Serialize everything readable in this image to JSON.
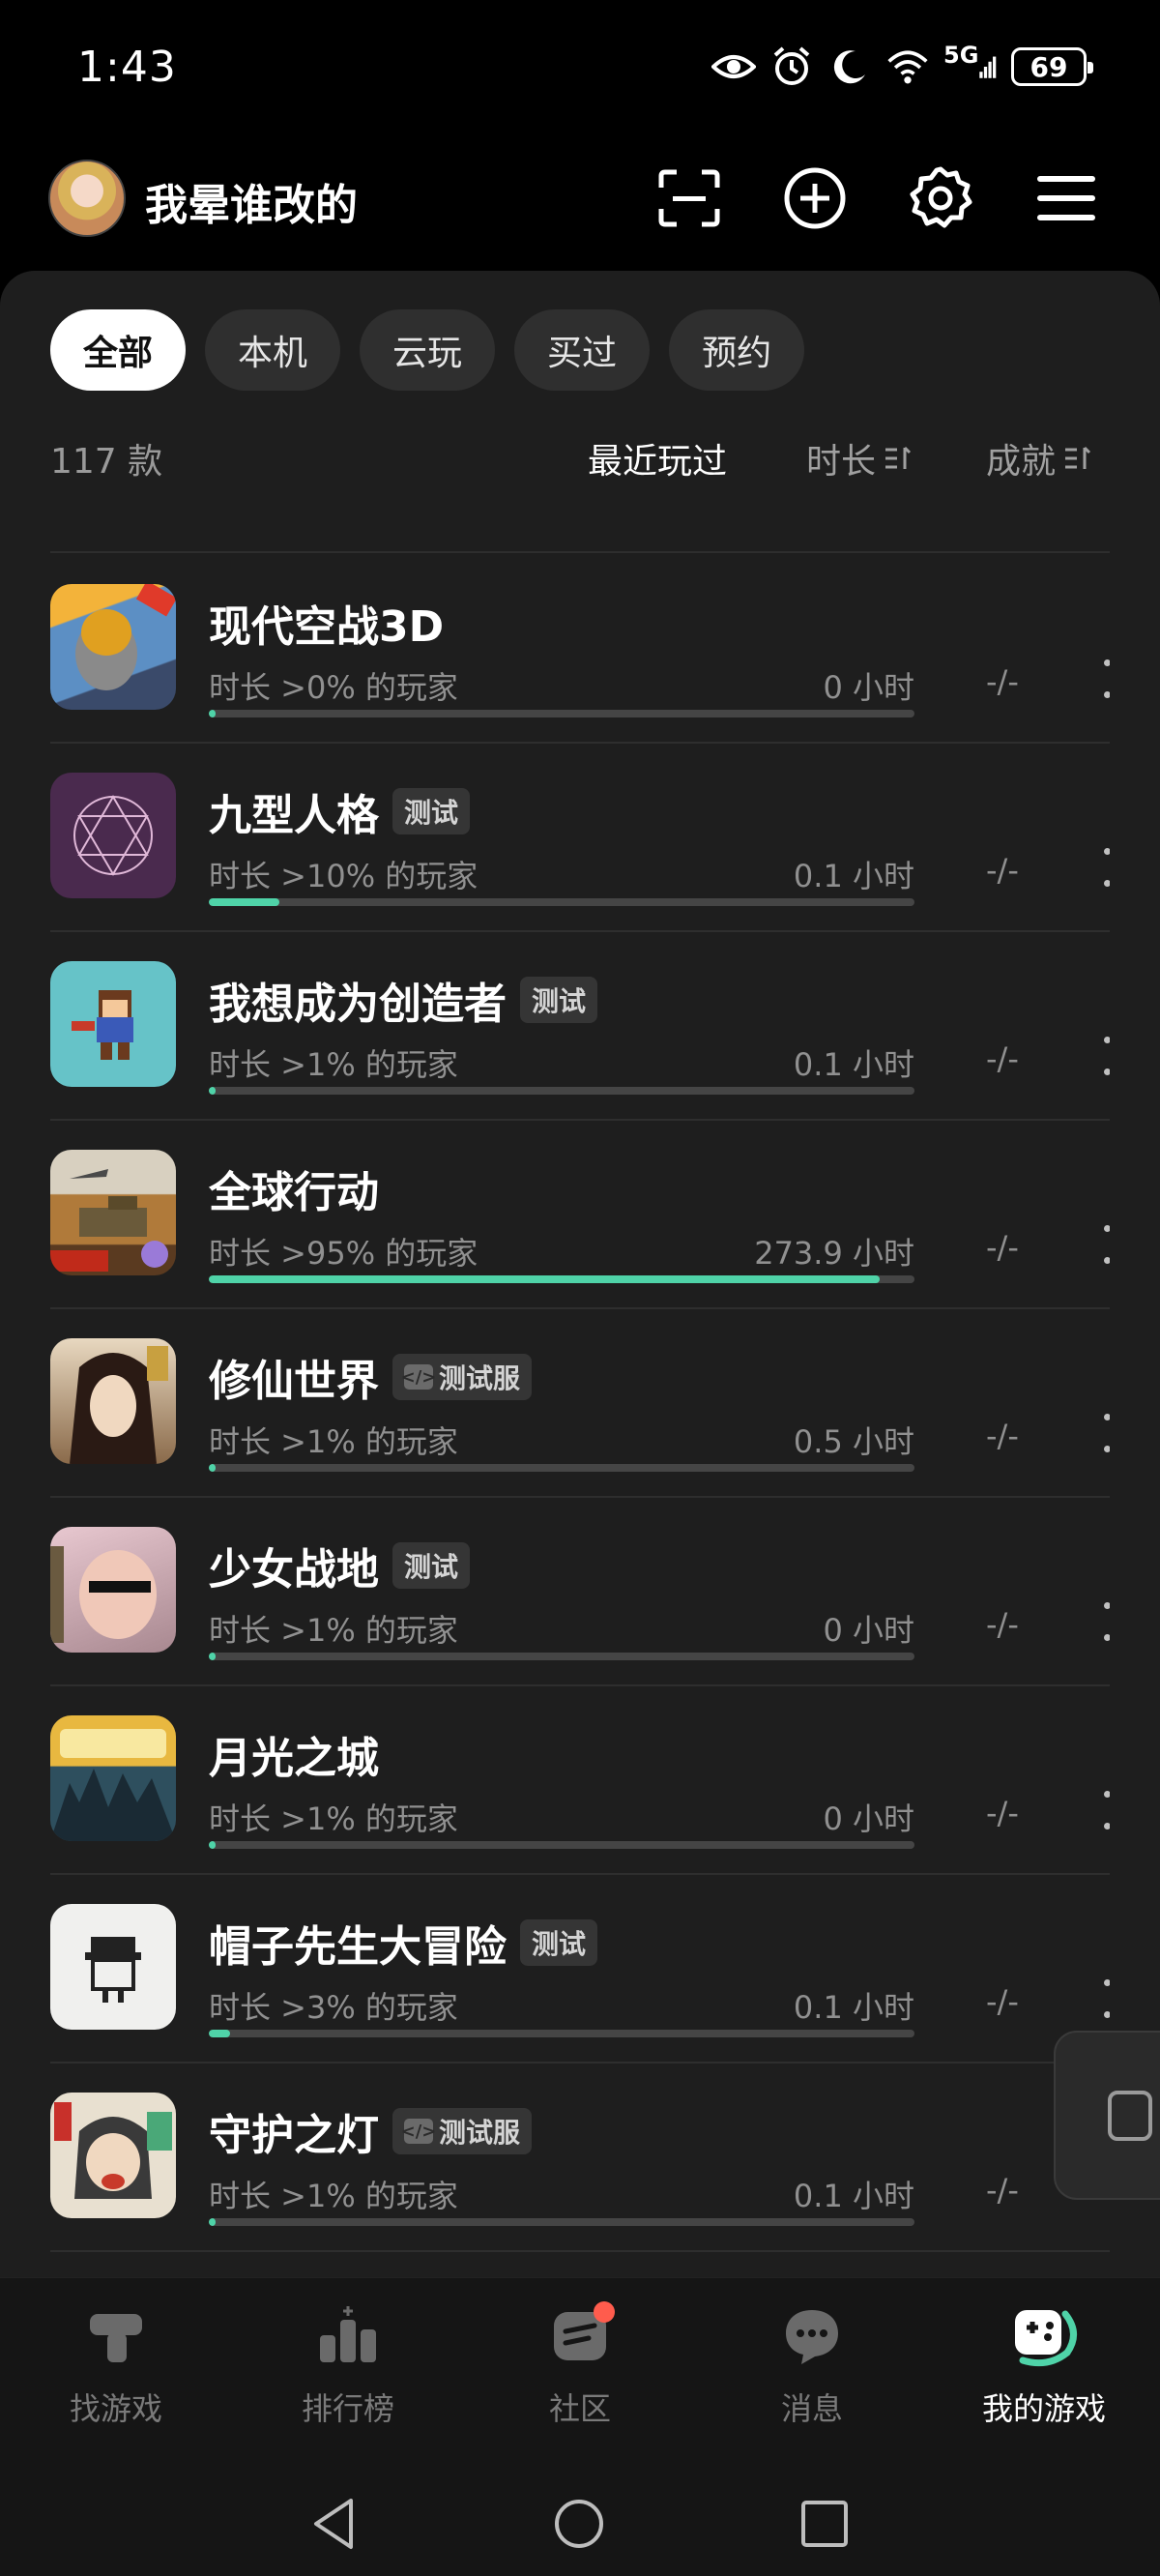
{
  "status_bar": {
    "time": "1:43",
    "network": "5G",
    "battery": "69",
    "icons": [
      "eye-icon",
      "alarm-icon",
      "moon-icon",
      "wifi-icon",
      "signal-icon",
      "battery-icon"
    ]
  },
  "header": {
    "username": "我晕谁改的",
    "icons": [
      "scan-icon",
      "add-icon",
      "settings-icon",
      "menu-icon"
    ]
  },
  "filters": {
    "tabs": [
      "全部",
      "本机",
      "云玩",
      "买过",
      "预约"
    ],
    "active": "全部"
  },
  "sort": {
    "count": "117 款",
    "recent": "最近玩过",
    "duration": "时长",
    "achievement": "成就"
  },
  "games": [
    {
      "name": "现代空战3D",
      "tag": "",
      "stat": "时长 >0% 的玩家",
      "hours": "0 小时",
      "progress": 0.01,
      "achievement": "-/-",
      "icon_color": "#3a7fbf"
    },
    {
      "name": "九型人格",
      "tag": "测试",
      "stat": "时长 >10% 的玩家",
      "hours": "0.1 小时",
      "progress": 0.1,
      "achievement": "-/-",
      "icon_color": "#4a2a4e"
    },
    {
      "name": "我想成为创造者",
      "tag": "测试",
      "stat": "时长 >1% 的玩家",
      "hours": "0.1 小时",
      "progress": 0.01,
      "achievement": "-/-",
      "icon_color": "#66c3c8"
    },
    {
      "name": "全球行动",
      "tag": "",
      "stat": "时长 >95% 的玩家",
      "hours": "273.9 小时",
      "progress": 0.95,
      "achievement": "-/-",
      "icon_color": "#9a6a3a"
    },
    {
      "name": "修仙世界",
      "tag": "测试服",
      "tag_code": true,
      "stat": "时长 >1% 的玩家",
      "hours": "0.5 小时",
      "progress": 0.01,
      "achievement": "-/-",
      "icon_color": "#6b5240"
    },
    {
      "name": "少女战地",
      "tag": "测试",
      "stat": "时长 >1% 的玩家",
      "hours": "0 小时",
      "progress": 0.01,
      "achievement": "-/-",
      "icon_color": "#c9a8a0"
    },
    {
      "name": "月光之城",
      "tag": "",
      "stat": "时长 >1% 的玩家",
      "hours": "0 小时",
      "progress": 0.01,
      "achievement": "-/-",
      "icon_color": "#2e4f5e"
    },
    {
      "name": "帽子先生大冒险",
      "tag": "测试",
      "stat": "时长 >3% 的玩家",
      "hours": "0.1 小时",
      "progress": 0.03,
      "achievement": "-/-",
      "icon_color": "#f0f0ee"
    },
    {
      "name": "守护之灯",
      "tag": "测试服",
      "tag_code": true,
      "stat": "时长 >1% 的玩家",
      "hours": "0.1 小时",
      "progress": 0.01,
      "achievement": "-/-",
      "icon_color": "#e8d8b8"
    }
  ],
  "bottom_nav": [
    {
      "label": "找游戏",
      "icon": "find-game-icon"
    },
    {
      "label": "排行榜",
      "icon": "ranking-icon"
    },
    {
      "label": "社区",
      "icon": "community-icon",
      "badge": true
    },
    {
      "label": "消息",
      "icon": "message-icon"
    },
    {
      "label": "我的游戏",
      "icon": "my-games-icon",
      "active": true
    }
  ],
  "colors": {
    "accent": "#4fd3a8",
    "background": "#1e1e1e",
    "badge": "#ff5c4d"
  }
}
